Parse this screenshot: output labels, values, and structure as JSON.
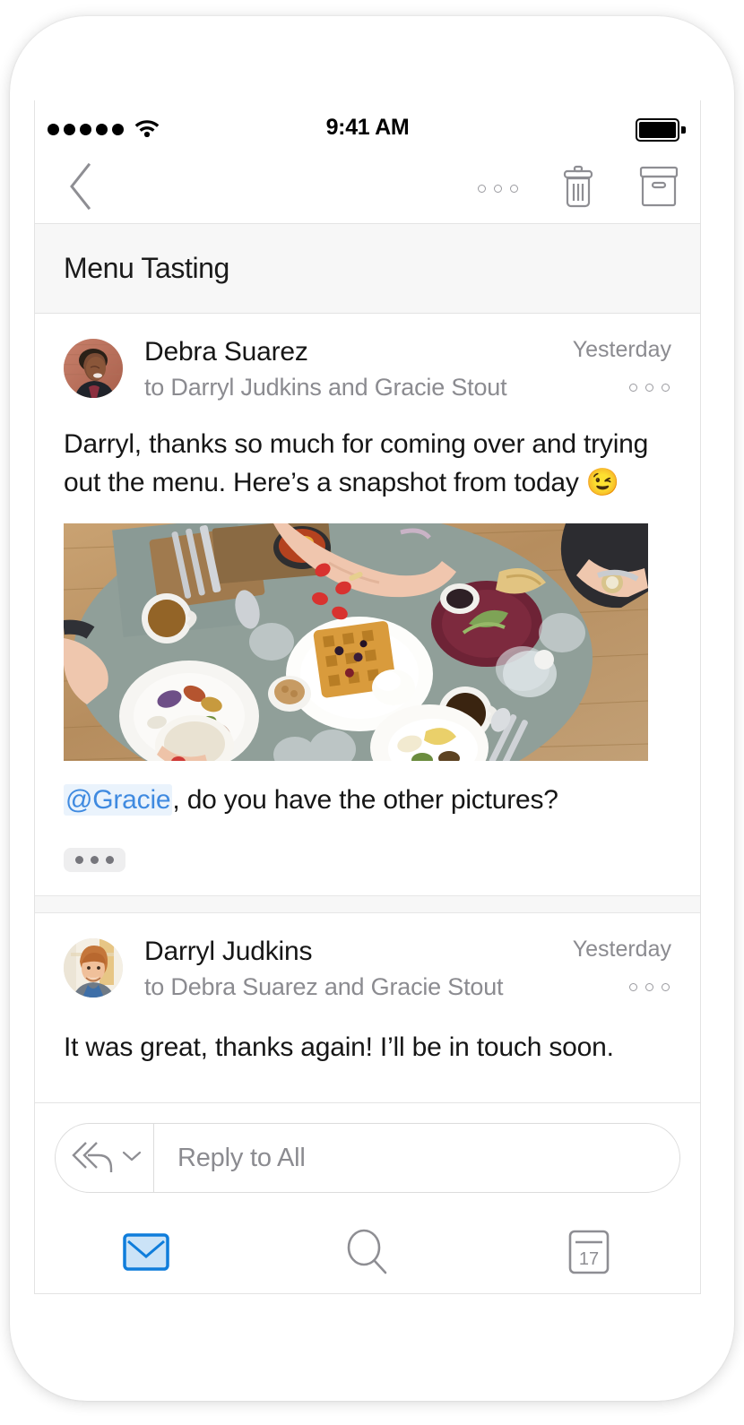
{
  "device": {
    "frame": "iphone-white"
  },
  "status_bar": {
    "signal_icon": "signal-dots-icon",
    "signal_bars": 5,
    "wifi_icon": "wifi-icon",
    "time": "9:41 AM",
    "battery_icon": "battery-full-icon"
  },
  "toolbar": {
    "back_icon": "chevron-left-icon",
    "more_icon": "more-horizontal-icon",
    "delete_icon": "trash-icon",
    "archive_icon": "archive-box-icon"
  },
  "header": {
    "subject": "Menu Tasting"
  },
  "messages": [
    {
      "avatar_name": "avatar-debra-suarez",
      "from": "Debra Suarez",
      "to": "to Darryl Judkins and Gracie Stout",
      "date": "Yesterday",
      "more_icon": "more-horizontal-icon",
      "body_part1": "Darryl, thanks so much for coming over and trying out the menu. Here’s a snapshot from today ",
      "body_emoji": "😉",
      "photo_name": "brunch-table-photo",
      "mention": "@Gracie",
      "body_after_mention": ", do you have the other pictures?",
      "expand_icon": "expand-quoted-text-icon"
    },
    {
      "avatar_name": "avatar-darryl-judkins",
      "from": "Darryl Judkins",
      "to": "to Debra Suarez and Gracie Stout",
      "date": "Yesterday",
      "more_icon": "more-horizontal-icon",
      "body": "It was great, thanks again! I’ll be in touch soon."
    }
  ],
  "reply": {
    "action_icon": "reply-all-icon",
    "chevron_icon": "chevron-down-icon",
    "placeholder": "Reply to All",
    "value": ""
  },
  "tabs": [
    {
      "name": "tab-mail",
      "icon": "mail-icon",
      "active": true
    },
    {
      "name": "tab-search",
      "icon": "search-icon",
      "active": false
    },
    {
      "name": "tab-calendar",
      "icon": "calendar-icon",
      "active": false,
      "day": "17"
    }
  ],
  "colors": {
    "accent": "#0f7ddb",
    "mention_text": "#3f8ae0",
    "mention_bg": "#eaf3fc",
    "secondary_text": "#8b8b90",
    "primary_text": "#161616",
    "subject_bg": "#f7f7f7",
    "divider": "#e3e3e3",
    "icon_gray": "#8e8e93"
  }
}
